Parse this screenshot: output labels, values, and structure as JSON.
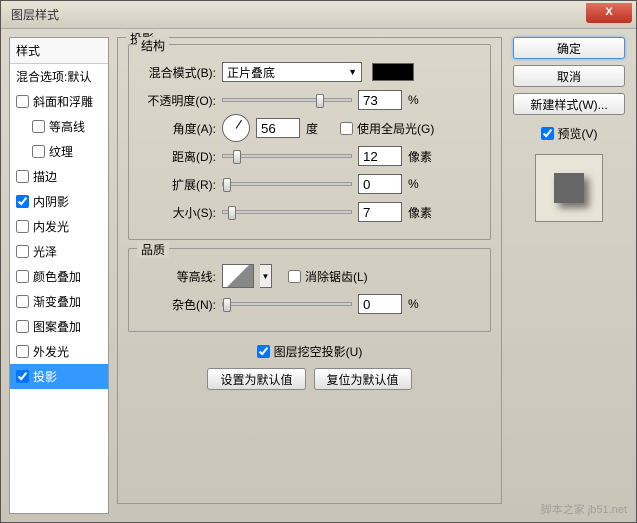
{
  "titlebar": {
    "title": "图层样式",
    "close": "X"
  },
  "styles": {
    "header": "样式",
    "blending": "混合选项:默认",
    "items": [
      {
        "label": "斜面和浮雕",
        "checked": false,
        "indent": 0
      },
      {
        "label": "等高线",
        "checked": false,
        "indent": 1
      },
      {
        "label": "纹理",
        "checked": false,
        "indent": 1
      },
      {
        "label": "描边",
        "checked": false,
        "indent": 0
      },
      {
        "label": "内阴影",
        "checked": true,
        "indent": 0
      },
      {
        "label": "内发光",
        "checked": false,
        "indent": 0
      },
      {
        "label": "光泽",
        "checked": false,
        "indent": 0
      },
      {
        "label": "颜色叠加",
        "checked": false,
        "indent": 0
      },
      {
        "label": "渐变叠加",
        "checked": false,
        "indent": 0
      },
      {
        "label": "图案叠加",
        "checked": false,
        "indent": 0
      },
      {
        "label": "外发光",
        "checked": false,
        "indent": 0
      },
      {
        "label": "投影",
        "checked": true,
        "indent": 0,
        "selected": true
      }
    ]
  },
  "main": {
    "section_title": "投影",
    "structure": {
      "legend": "结构",
      "blend": {
        "label": "混合模式(B):",
        "value": "正片叠底"
      },
      "opacity": {
        "label": "不透明度(O):",
        "value": "73",
        "unit": "%"
      },
      "angle": {
        "label": "角度(A):",
        "value": "56",
        "unit": "度",
        "global_label": "使用全局光(G)",
        "global_checked": false
      },
      "distance": {
        "label": "距离(D):",
        "value": "12",
        "unit": "像素"
      },
      "spread": {
        "label": "扩展(R):",
        "value": "0",
        "unit": "%"
      },
      "size": {
        "label": "大小(S):",
        "value": "7",
        "unit": "像素"
      }
    },
    "quality": {
      "legend": "品质",
      "contour": {
        "label": "等高线:",
        "antialias_label": "消除锯齿(L)",
        "antialias_checked": false
      },
      "noise": {
        "label": "杂色(N):",
        "value": "0",
        "unit": "%"
      }
    },
    "knockout": {
      "label": "图层挖空投影(U)",
      "checked": true
    },
    "buttons": {
      "default": "设置为默认值",
      "reset": "复位为默认值"
    }
  },
  "right": {
    "ok": "确定",
    "cancel": "取消",
    "new_style": "新建样式(W)...",
    "preview_label": "预览(V)",
    "preview_checked": true
  },
  "watermark": "脚本之家 jb51.net"
}
